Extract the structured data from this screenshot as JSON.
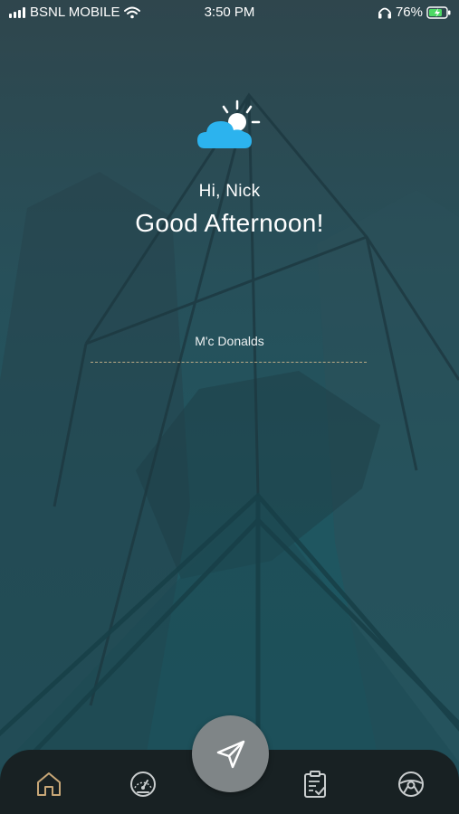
{
  "status_bar": {
    "carrier": "BSNL MOBILE",
    "time": "3:50 PM",
    "battery": "76%"
  },
  "greeting": {
    "name_line": "Hi, Nick",
    "message": "Good Afternoon!",
    "weather_icon": "partly-cloudy-icon"
  },
  "location": {
    "value": "M'c Donalds"
  },
  "bottom_nav": {
    "items": [
      {
        "icon": "home-icon",
        "active": true
      },
      {
        "icon": "speedometer-icon",
        "active": false
      },
      {
        "icon": "navigation-arrow-icon",
        "active": false
      },
      {
        "icon": "clipboard-check-icon",
        "active": false
      },
      {
        "icon": "steering-wheel-icon",
        "active": false
      }
    ]
  },
  "colors": {
    "accent_active": "#c8a777",
    "icon_inactive": "#c9cdce",
    "weather_cloud": "#2cb3ee",
    "nav_background": "#182123"
  }
}
